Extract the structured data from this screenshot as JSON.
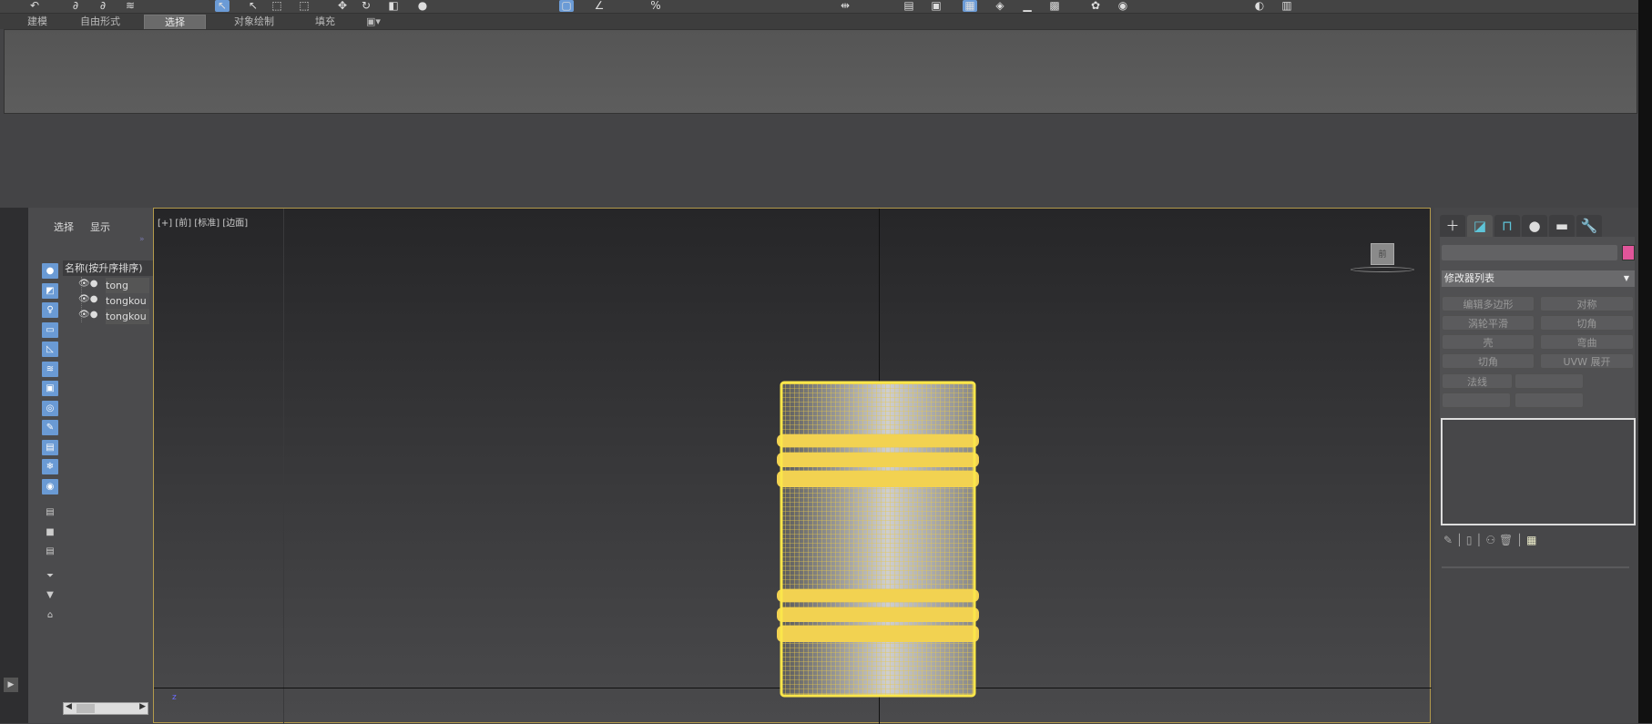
{
  "ribbon": {
    "tabs": [
      "建模",
      "自由形式",
      "选择",
      "对象绘制",
      "填充"
    ],
    "active_tab": "选择"
  },
  "toolbar": {
    "icons": [
      "undo-icon",
      "redo-icon",
      "link-icon",
      "select-icon",
      "select-region-icon",
      "move-icon",
      "rotate-icon",
      "scale-icon",
      "snap-icon",
      "angle-snap-icon",
      "percent-snap-icon",
      "mirror-icon",
      "align-icon",
      "layer-icon",
      "scene-explorer-icon",
      "curve-editor-icon",
      "schematic-icon",
      "material-editor-icon",
      "render-setup-icon",
      "render-frame-icon",
      "render-icon"
    ]
  },
  "explorer": {
    "tabs": [
      "选择",
      "显示"
    ],
    "column_header": "名称(按升序排序)",
    "objects": [
      "tong",
      "tongkou",
      "tongkou"
    ]
  },
  "viewport": {
    "label": [
      "[+]",
      "[前]",
      "[标准]",
      "[边面]"
    ],
    "viewcube_label": "前"
  },
  "command_panel": {
    "tabs": [
      "create-icon",
      "modify-icon",
      "hierarchy-icon",
      "motion-icon",
      "display-icon",
      "utilities-icon"
    ],
    "object_name": "",
    "object_color": "#e0559a",
    "modifier_list": "修改器列表",
    "modifier_buttons": [
      "编辑多边形",
      "对称",
      "涡轮平滑",
      "切角",
      "壳",
      "弯曲",
      "切角",
      "UVW 展开",
      "法线"
    ]
  },
  "colors": {
    "selection": "#f5d94a",
    "accent": "#6a9ad4"
  }
}
